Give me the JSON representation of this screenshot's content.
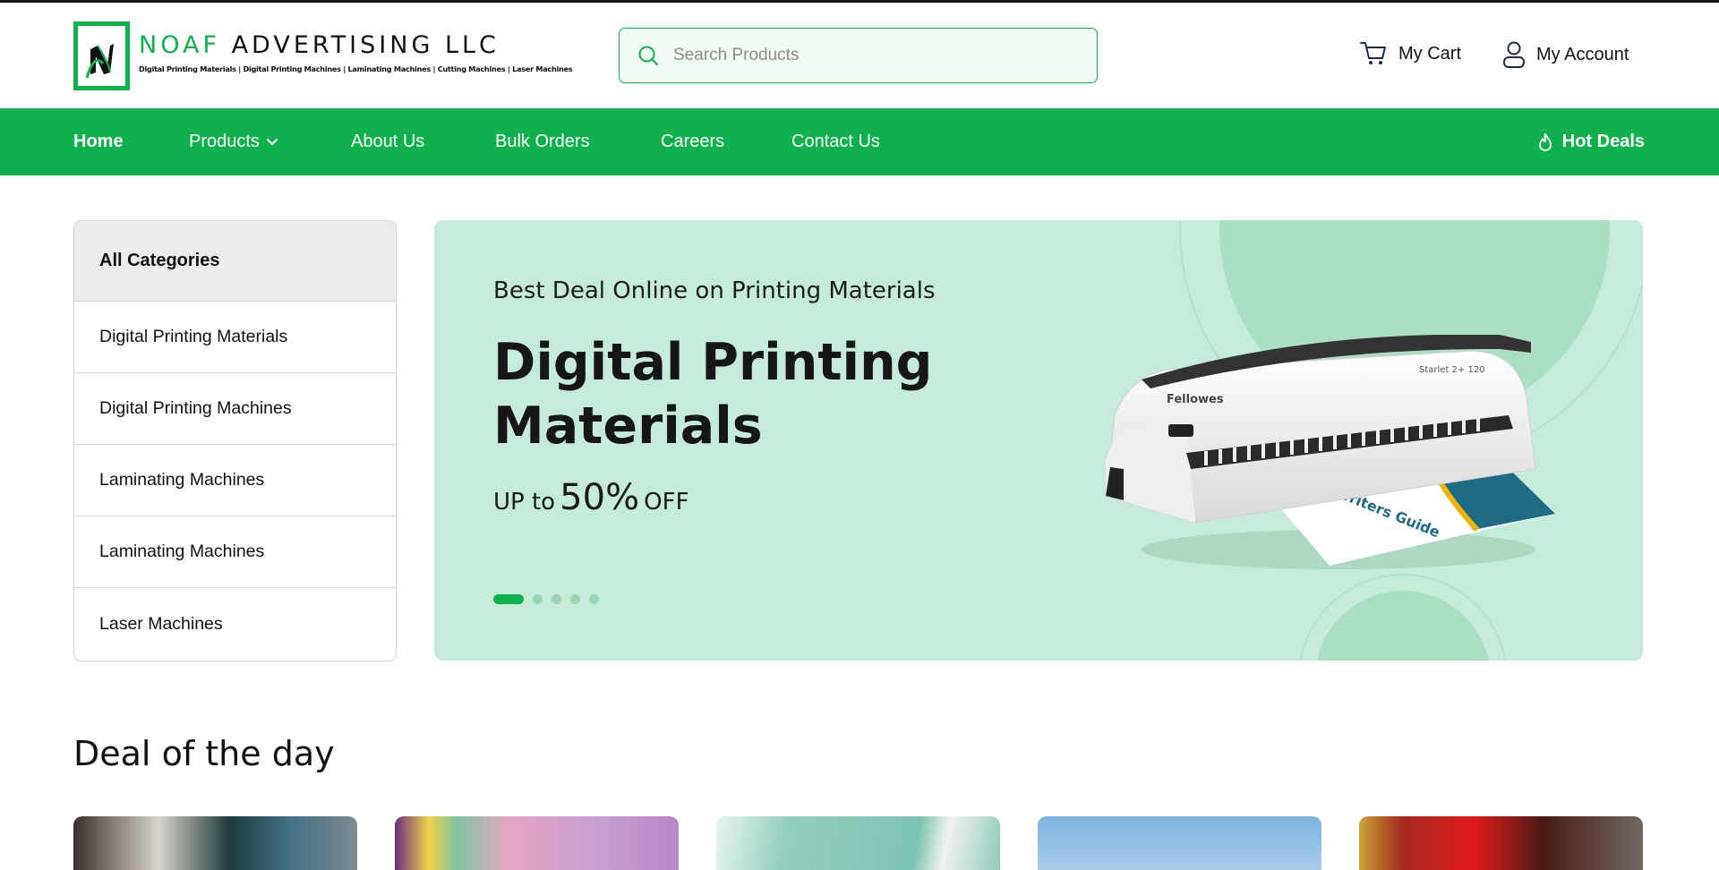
{
  "brand": {
    "name_part1": "NOAF",
    "name_part2": "ADVERTISING LLC",
    "tagline": "Digital Printing Materials | Digital Printing Machines | Laminating Machines | Cutting Machines | Laser Machines",
    "primary_color": "#0fb14d"
  },
  "search": {
    "placeholder": "Search Products",
    "icon": "search-icon"
  },
  "header_links": {
    "cart_label": "My Cart",
    "account_label": "My Account"
  },
  "nav": {
    "home": "Home",
    "products": "Products",
    "about": "About Us",
    "bulk": "Bulk Orders",
    "careers": "Careers",
    "contact": "Contact Us",
    "hot_deals": "Hot Deals"
  },
  "sidebar": {
    "title": "All Categories",
    "items": [
      {
        "label": "Digital Printing Materials"
      },
      {
        "label": "Digital Printing Machines"
      },
      {
        "label": "Laminating Machines"
      },
      {
        "label": "Laminating Machines"
      },
      {
        "label": "Laser Machines"
      }
    ]
  },
  "hero": {
    "subtitle": "Best Deal Online on Printing Materials",
    "title": "Digital Printing Materials",
    "offer_prefix": "UP to",
    "offer_value": "50%",
    "offer_suffix": "OFF",
    "slide_count": 5,
    "active_slide": 1,
    "product_brand": "Fellowes",
    "product_model": "Starlet 2+ 120",
    "product_booklet": "Writers Guide",
    "background_color": "#c5ebd9"
  },
  "deals": {
    "title": "Deal of the day"
  }
}
